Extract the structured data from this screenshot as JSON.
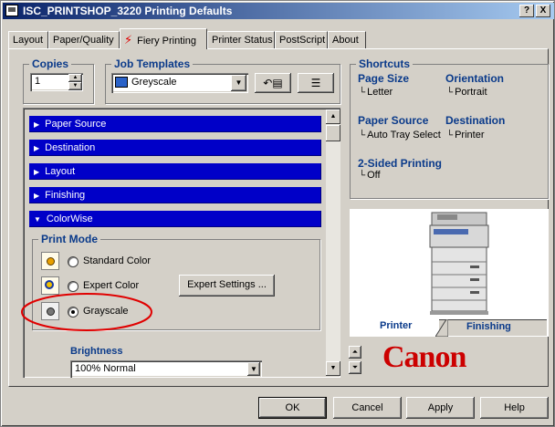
{
  "window": {
    "title": "ISC_PRINTSHOP_3220 Printing Defaults",
    "help_glyph": "?",
    "close_glyph": "X"
  },
  "tabs": [
    {
      "label": "Layout"
    },
    {
      "label": "Paper/Quality"
    },
    {
      "label": "Fiery Printing",
      "active": true
    },
    {
      "label": "Printer Status"
    },
    {
      "label": "PostScript"
    },
    {
      "label": "About"
    }
  ],
  "copies": {
    "label": "Copies",
    "value": "1"
  },
  "job_templates": {
    "label": "Job Templates",
    "selected": "Greyscale"
  },
  "sections": [
    {
      "label": "Paper Source",
      "expanded": false
    },
    {
      "label": "Destination",
      "expanded": false
    },
    {
      "label": "Layout",
      "expanded": false
    },
    {
      "label": "Finishing",
      "expanded": false
    },
    {
      "label": "ColorWise",
      "expanded": true
    }
  ],
  "print_mode": {
    "label": "Print Mode",
    "options": [
      {
        "label": "Standard Color",
        "checked": false
      },
      {
        "label": "Expert Color",
        "checked": false
      },
      {
        "label": "Grayscale",
        "checked": true
      }
    ],
    "expert_settings_button": "Expert Settings ..."
  },
  "brightness": {
    "label": "Brightness",
    "value": "100% Normal"
  },
  "shortcuts": {
    "label": "Shortcuts",
    "page_size": {
      "label": "Page Size",
      "value": "Letter"
    },
    "orientation": {
      "label": "Orientation",
      "value": "Portrait"
    },
    "paper_source": {
      "label": "Paper Source",
      "value": "Auto Tray Select"
    },
    "destination": {
      "label": "Destination",
      "value": "Printer"
    },
    "two_sided": {
      "label": "2-Sided Printing",
      "value": "Off"
    }
  },
  "preview": {
    "tab_printer": "Printer",
    "tab_finishing": "Finishing"
  },
  "logo_text": "Canon",
  "buttons": {
    "ok": "OK",
    "cancel": "Cancel",
    "apply": "Apply",
    "help": "Help"
  },
  "colors": {
    "title_gradient_start": "#0a246a",
    "section_bar": "#0000c8",
    "group_label": "#0a3a8a",
    "highlight_ellipse": "#e00000",
    "logo": "#cc0000"
  }
}
